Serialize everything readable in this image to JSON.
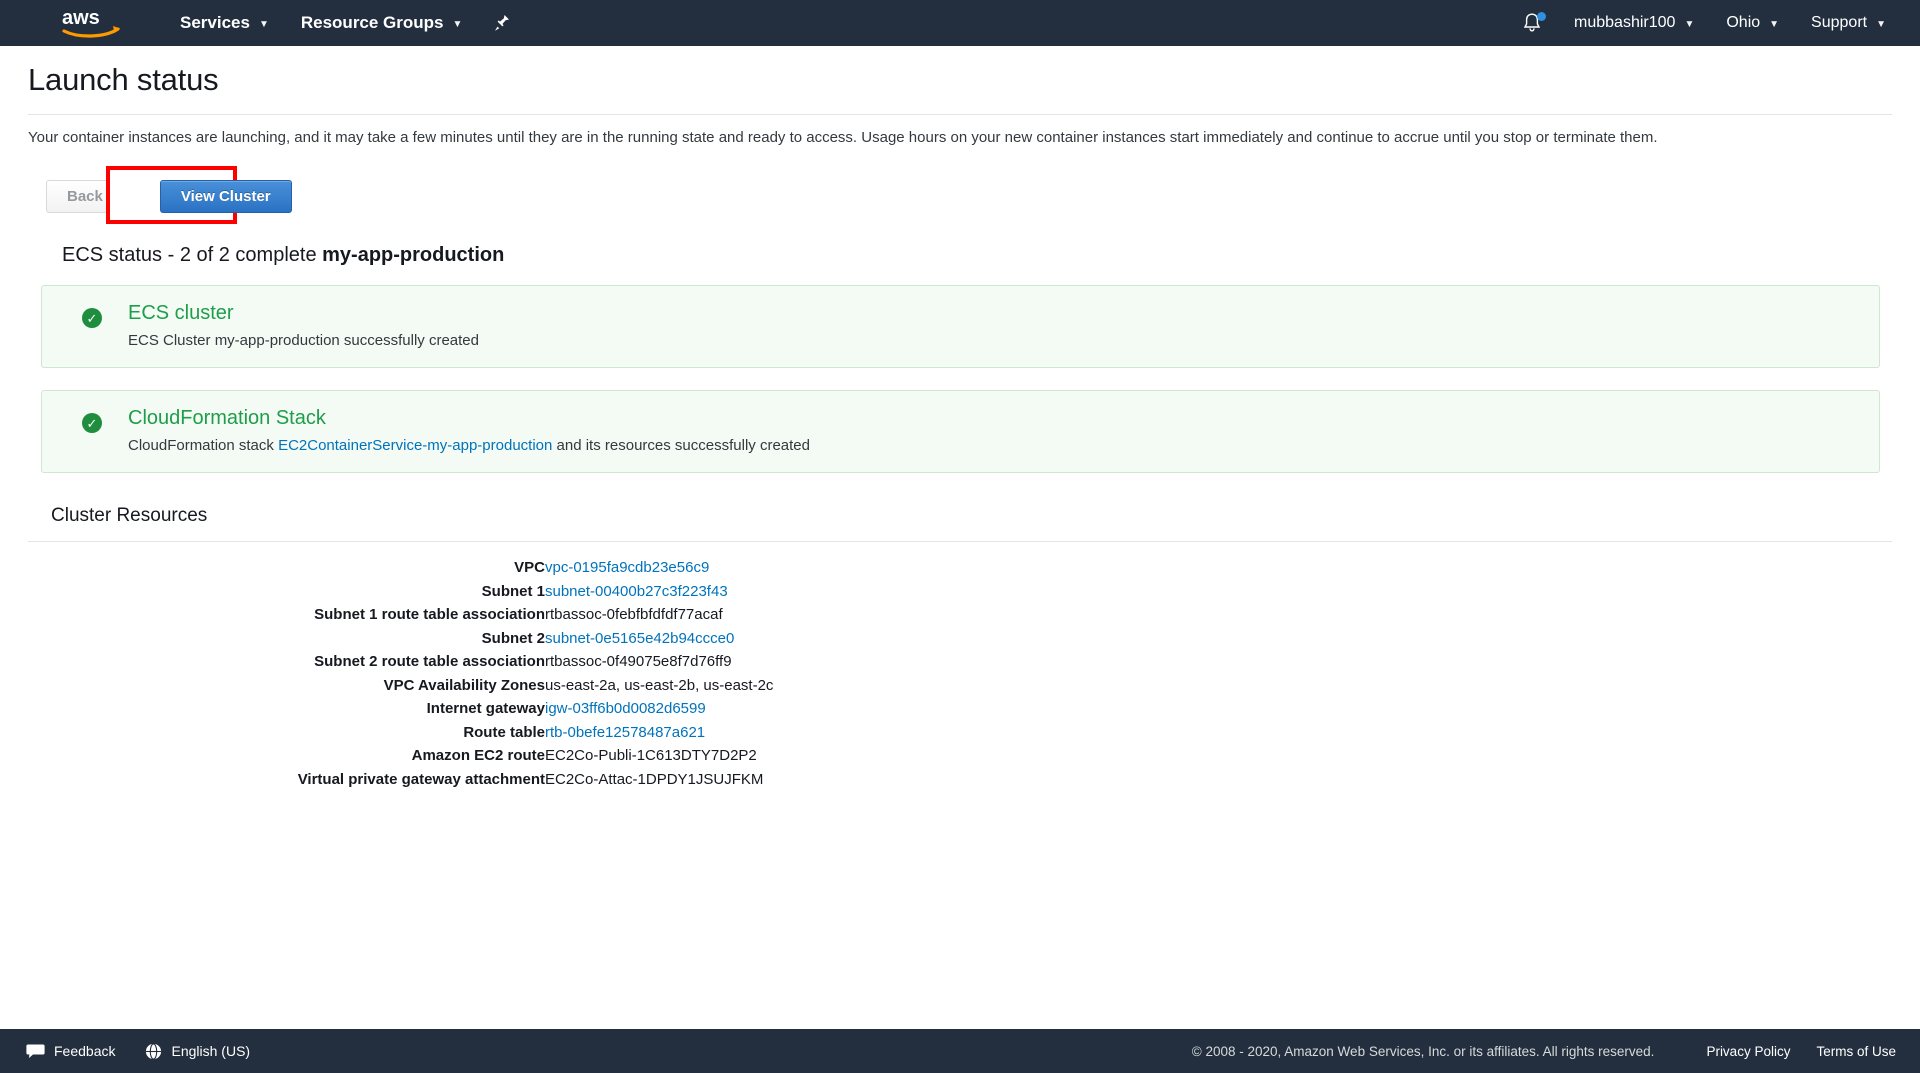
{
  "navbar": {
    "logo_alt": "aws",
    "services_label": "Services",
    "resource_groups_label": "Resource Groups",
    "pin_icon": "pin-icon",
    "bell_icon": "bell-icon",
    "account_label": "mubbashir100",
    "region_label": "Ohio",
    "support_label": "Support",
    "caret": "▼"
  },
  "page": {
    "title": "Launch status",
    "lead": "Your container instances are launching, and it may take a few minutes until they are in the running state and ready to access. Usage hours on your new container instances start immediately and continue to accrue until you stop or terminate them."
  },
  "actions": {
    "back_label": "Back",
    "view_cluster_label": "View Cluster",
    "highlight_color": "#ff0000"
  },
  "status": {
    "heading_prefix": "ECS status - 2 of 2 complete ",
    "heading_cluster": "my-app-production",
    "check_icon": "check-circle-icon",
    "panels": [
      {
        "title": "ECS cluster",
        "text_before": "ECS Cluster my-app-production successfully created",
        "link": "",
        "text_after": ""
      },
      {
        "title": "CloudFormation Stack",
        "text_before": "CloudFormation stack ",
        "link": "EC2ContainerService-my-app-production",
        "text_after": " and its resources successfully created"
      }
    ]
  },
  "resources": {
    "heading": "Cluster Resources",
    "rows": [
      {
        "label": "VPC",
        "value": "vpc-0195fa9cdb23e56c9",
        "is_link": true
      },
      {
        "label": "Subnet 1",
        "value": "subnet-00400b27c3f223f43",
        "is_link": true
      },
      {
        "label": "Subnet 1 route table association",
        "value": "rtbassoc-0febfbfdfdf77acaf",
        "is_link": false
      },
      {
        "label": "Subnet 2",
        "value": "subnet-0e5165e42b94ccce0",
        "is_link": true
      },
      {
        "label": "Subnet 2 route table association",
        "value": "rtbassoc-0f49075e8f7d76ff9",
        "is_link": false
      },
      {
        "label": "VPC Availability Zones",
        "value": "us-east-2a, us-east-2b, us-east-2c",
        "is_link": false
      },
      {
        "label": "Internet gateway",
        "value": "igw-03ff6b0d0082d6599",
        "is_link": true
      },
      {
        "label": "Route table",
        "value": "rtb-0befe12578487a621",
        "is_link": true
      },
      {
        "label": "Amazon EC2 route",
        "value": "EC2Co-Publi-1C613DTY7D2P2",
        "is_link": false
      },
      {
        "label": "Virtual private gateway attachment",
        "value": "EC2Co-Attac-1DPDY1JSUJFKM",
        "is_link": false
      }
    ]
  },
  "footer": {
    "feedback_label": "Feedback",
    "feedback_icon": "speech-bubble-icon",
    "language_label": "English (US)",
    "language_icon": "globe-icon",
    "copyright": "© 2008 - 2020, Amazon Web Services, Inc. or its affiliates. All rights reserved.",
    "privacy_label": "Privacy Policy",
    "terms_label": "Terms of Use"
  }
}
